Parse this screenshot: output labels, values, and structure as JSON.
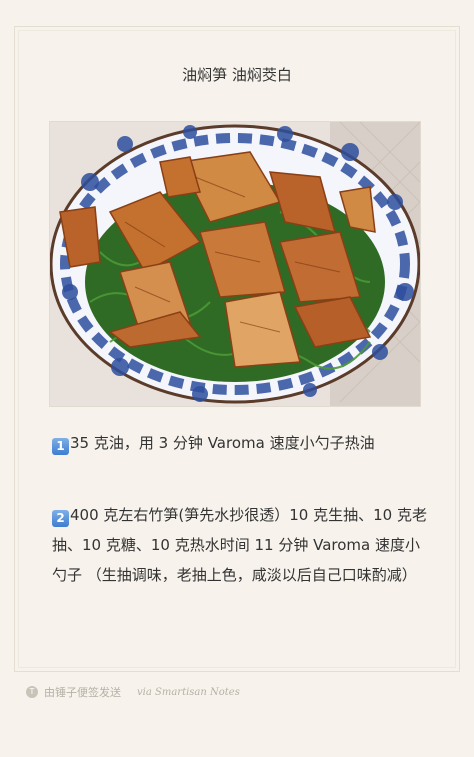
{
  "note": {
    "title": "油焖笋 油焖茭白",
    "steps": [
      {
        "icon_text": "1",
        "text": "35 克油，用 3 分钟 Varoma 速度小勺子热油"
      },
      {
        "icon_text": "2",
        "text": "400 克左右竹笋(笋先水抄很透）10 克生抽、10 克老抽、10 克糖、10 克热水时间 11 分钟 Varoma 速度小勺子 （生抽调味，老抽上色，咸淡以后自己口味酌减）"
      }
    ]
  },
  "footer": {
    "app_text": "由锤子便签发送",
    "via_text": "via Smartisan Notes"
  },
  "photo": {
    "icon": "food-photo",
    "colors": {
      "plate_blue": "#2e4f9e",
      "bamboo": "#c4702e",
      "greens": "#2f6b25"
    }
  }
}
